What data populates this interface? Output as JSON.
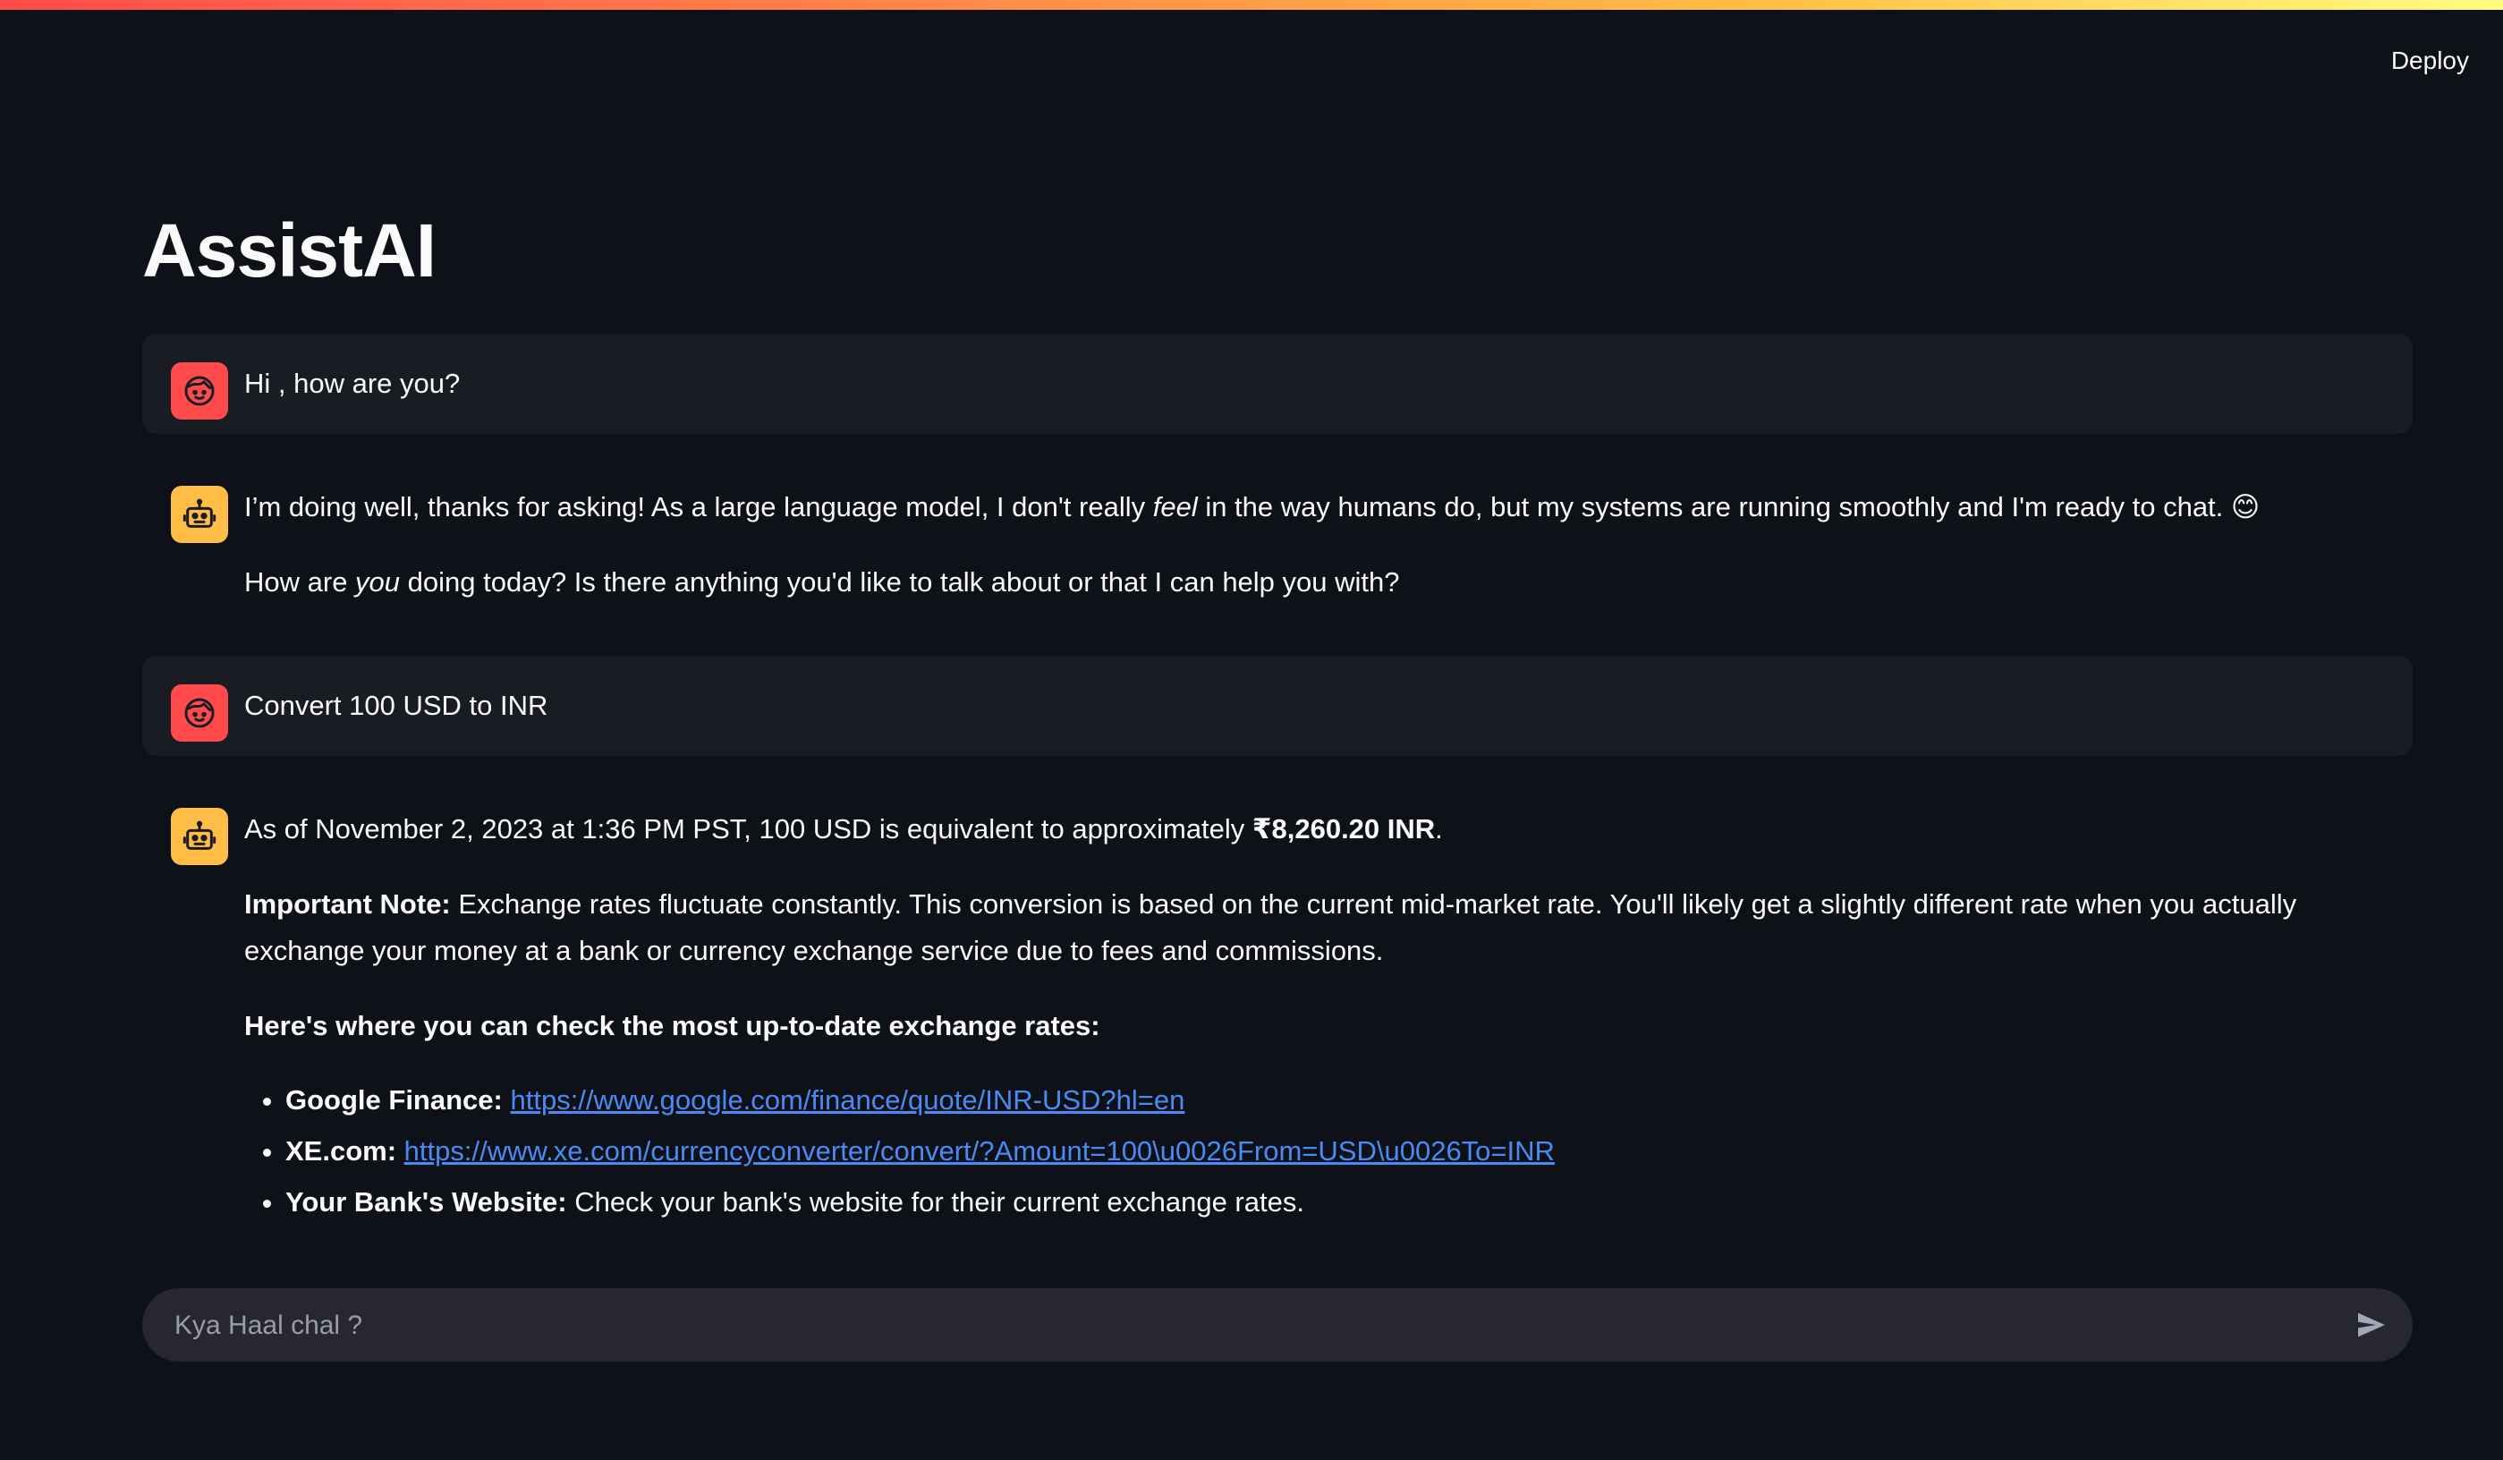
{
  "header": {
    "deploy_label": "Deploy"
  },
  "app": {
    "title": "AssistAI"
  },
  "messages": {
    "m1": {
      "role": "user",
      "text": "Hi , how are you?"
    },
    "m2": {
      "role": "assistant",
      "p1_a": "I’m doing well, thanks for asking! As a large language model, I don't really ",
      "p1_em": "feel",
      "p1_b": " in the way humans do, but my systems are running smoothly and I'm ready to chat. 😊",
      "p2_a": "How are ",
      "p2_em": "you",
      "p2_b": " doing today? Is there anything you'd like to talk about or that I can help you with?"
    },
    "m3": {
      "role": "user",
      "text": "Convert 100 USD to INR"
    },
    "m4": {
      "role": "assistant",
      "p1_a": "As of November 2, 2023 at 1:36 PM PST, 100 USD is equivalent to approximately ",
      "p1_strong": "₹8,260.20 INR",
      "p1_b": ".",
      "note_label": "Important Note:",
      "note_text": " Exchange rates fluctuate constantly. This conversion is based on the current mid-market rate. You'll likely get a slightly different rate when you actually exchange your money at a bank or currency exchange service due to fees and commissions.",
      "sources_heading": "Here's where you can check the most up-to-date exchange rates:",
      "sources": [
        {
          "label": "Google Finance:",
          "link": "https://www.google.com/finance/quote/INR-USD?hl=en"
        },
        {
          "label": "XE.com:",
          "link": "https://www.xe.com/currencyconverter/convert/?Amount=100\\u0026From=USD\\u0026To=INR"
        },
        {
          "label": "Your Bank's Website:",
          "text": " Check your bank's website for their current exchange rates."
        }
      ]
    }
  },
  "input": {
    "placeholder": "Kya Haal chal ?",
    "value": ""
  },
  "icons": {
    "user_avatar": "face-icon",
    "bot_avatar": "robot-icon",
    "send": "send-icon"
  },
  "colors": {
    "background": "#0e1117",
    "user_bubble": "#1a1c24",
    "user_avatar": "#ff4b4b",
    "bot_avatar": "#ffbd45",
    "link": "#4a8af4",
    "input_bg": "#262730"
  }
}
